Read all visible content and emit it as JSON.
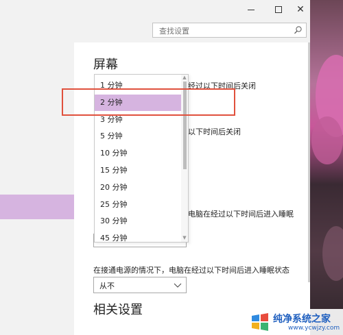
{
  "search": {
    "placeholder": "查找设置"
  },
  "screen": {
    "title": "屏幕",
    "label_battery_screen_off": "经过以下时间后关闭",
    "label_plugged_screen_off": "以下时间后关闭",
    "label_battery_sleep": "电脑在经过以下时间后进入睡眠",
    "label_plugged_sleep": "在接通电源的情况下，电脑在经过以下时间后进入睡眠状态",
    "plugged_sleep_value": "从不"
  },
  "dropdown": {
    "selected_index": 1,
    "options": [
      "1 分钟",
      "2 分钟",
      "3 分钟",
      "5 分钟",
      "10 分钟",
      "15 分钟",
      "20 分钟",
      "25 分钟",
      "30 分钟",
      "45 分钟"
    ]
  },
  "related": {
    "title": "相关设置"
  },
  "watermark": {
    "title": "纯净系统之家",
    "url": "www.ycwjzy.com"
  },
  "colors": {
    "selection": "#d6b4e0",
    "annotation": "#e0503c",
    "watermark": "#1f5fbf"
  }
}
